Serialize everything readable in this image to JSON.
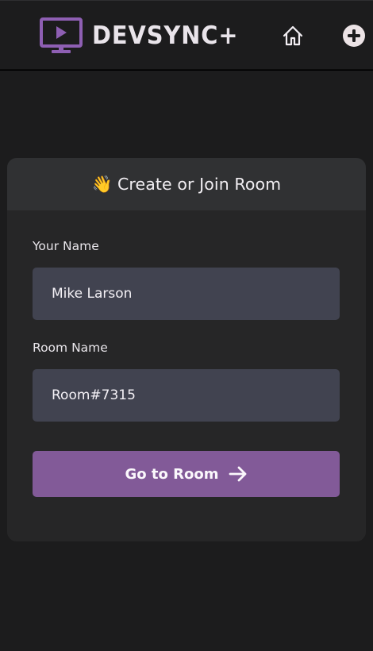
{
  "navbar": {
    "brand": "DEVSYNC+",
    "icons": {
      "logo": "tv-play-icon",
      "home": "home-icon",
      "add": "plus-circle-icon"
    }
  },
  "form": {
    "title": "Create or Join Room",
    "title_emoji": "👋",
    "name_label": "Your Name",
    "name_value": "Mike Larson",
    "room_label": "Room Name",
    "room_value": "Room#7315",
    "submit_label": "Go to Room",
    "submit_icon": "arrow-right-icon"
  },
  "colors": {
    "background": "#1c1c1d",
    "card": "#262627",
    "card_header": "#303133",
    "input": "#414350",
    "accent": "#825a98",
    "logo": "#8e5fb3"
  }
}
